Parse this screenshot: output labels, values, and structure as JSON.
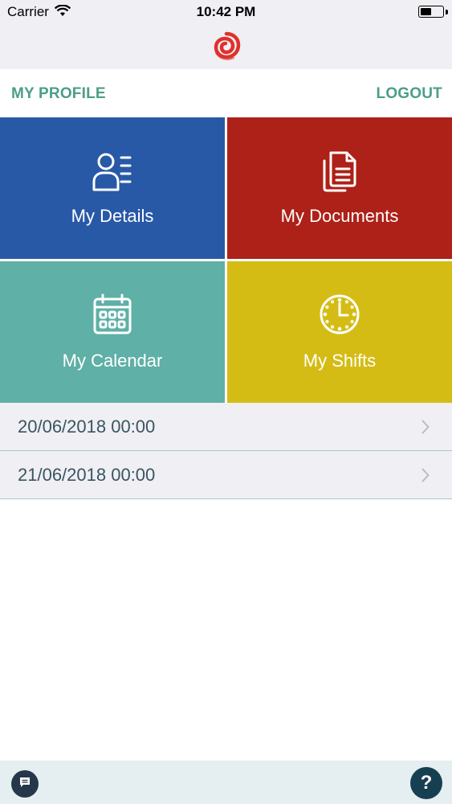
{
  "status_bar": {
    "carrier": "Carrier",
    "time": "10:42 PM",
    "icons": [
      "wifi-icon",
      "battery-icon"
    ]
  },
  "header": {
    "logo": "brand-swirl-logo",
    "brand_color": "#e0302a"
  },
  "nav": {
    "profile_label": "MY PROFILE",
    "logout_label": "LOGOUT",
    "link_color": "#4c9e88"
  },
  "tiles": [
    {
      "label": "My Details",
      "icon": "person-list-icon",
      "color": "#2859a6"
    },
    {
      "label": "My Documents",
      "icon": "documents-icon",
      "color": "#ad2118"
    },
    {
      "label": "My Calendar",
      "icon": "calendar-icon",
      "color": "#5fb0a6"
    },
    {
      "label": "My Shifts",
      "icon": "clock-icon",
      "color": "#d4bc15"
    }
  ],
  "shifts": [
    {
      "datetime": "20/06/2018 00:00"
    },
    {
      "datetime": "21/06/2018 00:00"
    }
  ],
  "footer": {
    "chat_icon": "chat-icon",
    "help_label": "?"
  }
}
